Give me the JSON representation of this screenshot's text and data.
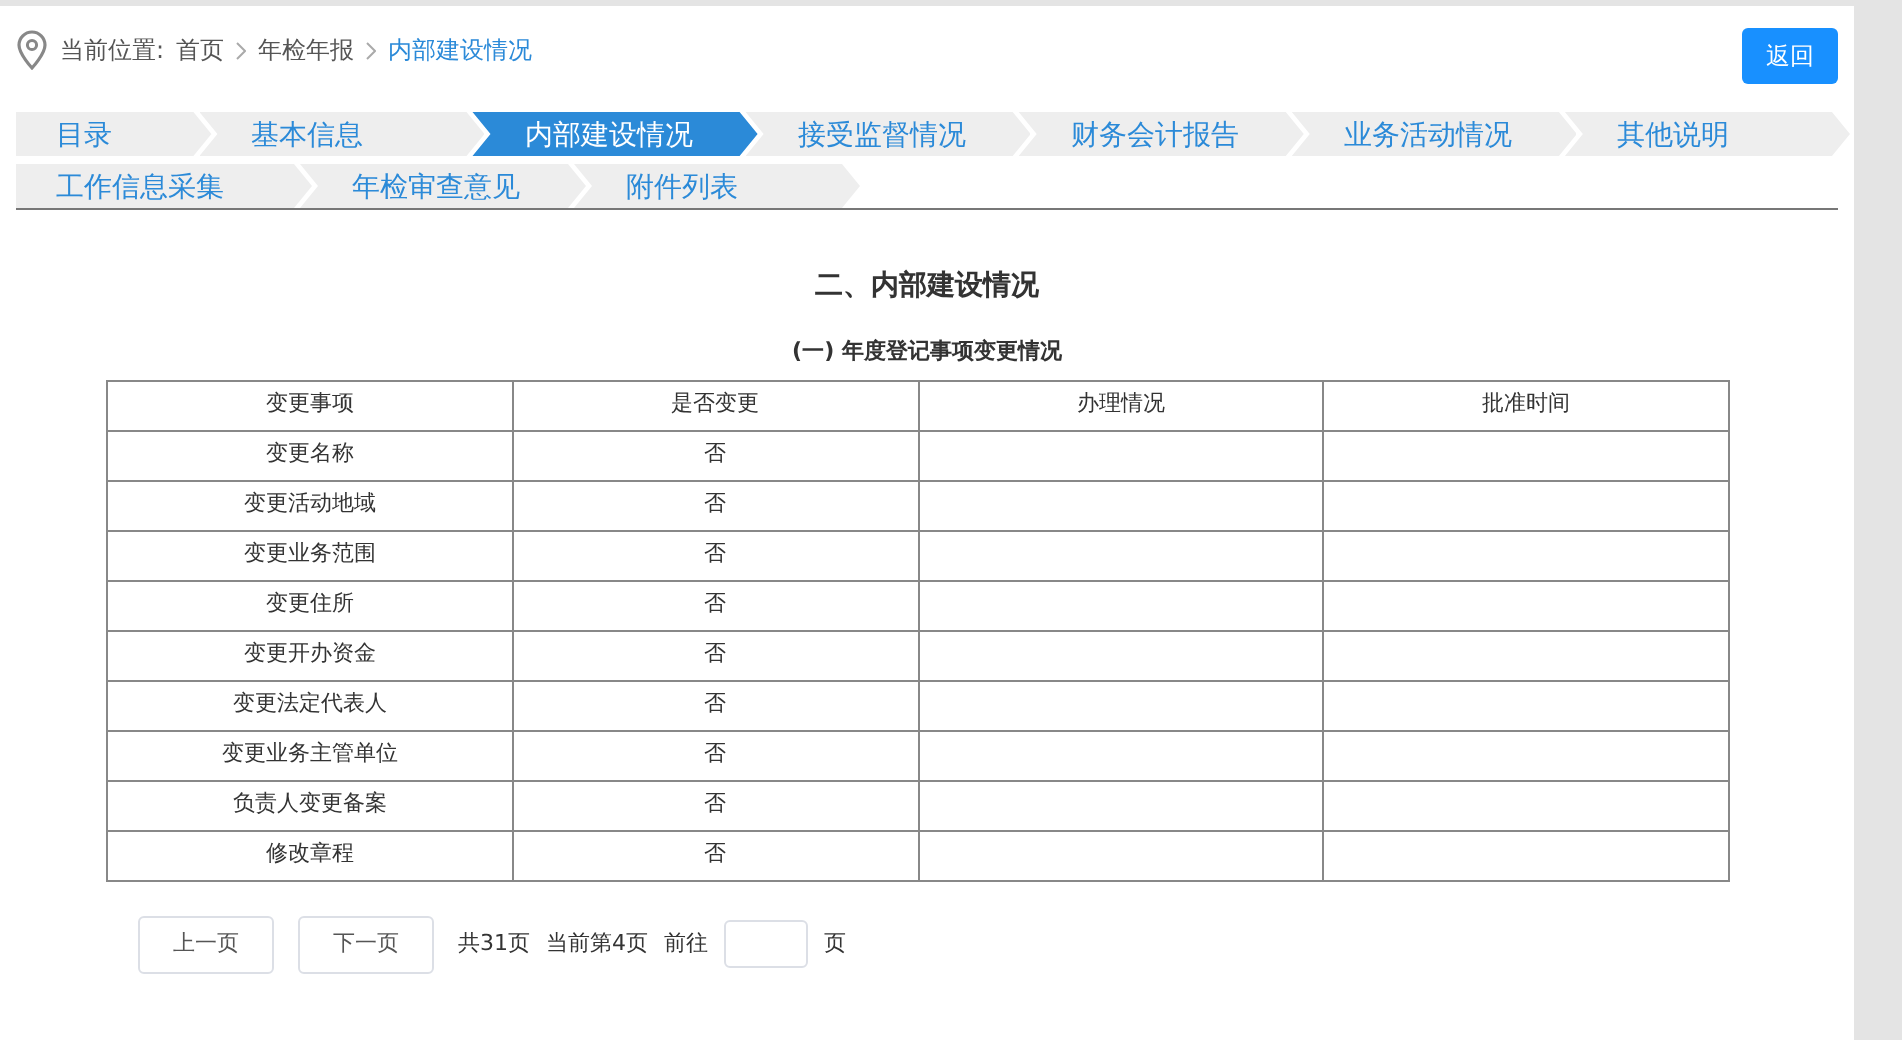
{
  "breadcrumb": {
    "label": "当前位置:",
    "items": [
      {
        "text": "首页",
        "current": false
      },
      {
        "text": "年检年报",
        "current": false
      },
      {
        "text": "内部建设情况",
        "current": true
      }
    ]
  },
  "back_button": "返回",
  "tabs": [
    [
      {
        "label": "目录",
        "selected": false
      },
      {
        "label": "基本信息",
        "selected": false
      },
      {
        "label": "内部建设情况",
        "selected": true
      },
      {
        "label": "接受监督情况",
        "selected": false
      },
      {
        "label": "财务会计报告",
        "selected": false
      },
      {
        "label": "业务活动情况",
        "selected": false
      },
      {
        "label": "其他说明",
        "selected": false
      }
    ],
    [
      {
        "label": "工作信息采集",
        "selected": false
      },
      {
        "label": "年检审查意见",
        "selected": false
      },
      {
        "label": "附件列表",
        "selected": false
      }
    ]
  ],
  "section_title": "二、内部建设情况",
  "table": {
    "title": "(一) 年度登记事项变更情况",
    "columns": [
      "变更事项",
      "是否变更",
      "办理情况",
      "批准时间"
    ],
    "rows": [
      [
        "变更名称",
        "否"
      ],
      [
        "变更活动地域",
        "否"
      ],
      [
        "变更业务范围",
        "否"
      ],
      [
        "变更住所",
        "否"
      ],
      [
        "变更开办资金",
        "否"
      ],
      [
        "变更法定代表人",
        "否"
      ],
      [
        "变更业务主管单位",
        "否"
      ],
      [
        "负责人变更备案",
        "否"
      ],
      [
        "修改章程",
        "否"
      ]
    ]
  },
  "pagination": {
    "prev": "上一页",
    "next": "下一页",
    "total": "共31页",
    "current": "当前第4页",
    "goto": "前往",
    "unit": "页"
  }
}
